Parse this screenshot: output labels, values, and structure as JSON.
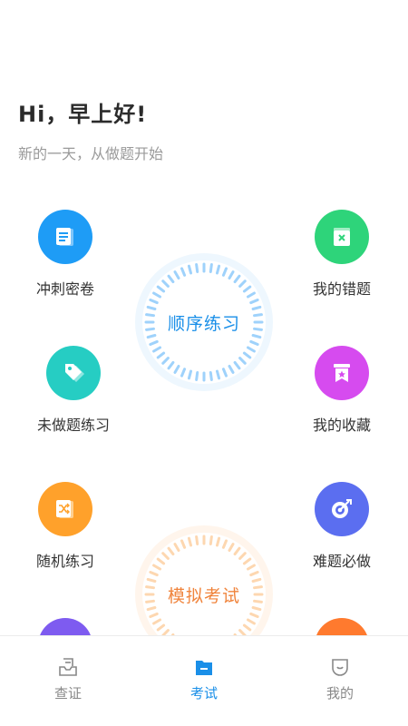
{
  "header": {
    "greeting": "Hi，早上好!",
    "subtitle": "新的一天，从做题开始"
  },
  "features": {
    "left": [
      {
        "label": "冲刺密卷",
        "color": "#1e9cf6",
        "icon": "document-icon"
      },
      {
        "label": "未做题练习",
        "color": "#26cdc3",
        "icon": "tag-icon"
      },
      {
        "label": "随机练习",
        "color": "#ffa12b",
        "icon": "shuffle-icon"
      },
      {
        "label": "",
        "color": "#7e5bf0",
        "icon": "unknown-icon"
      }
    ],
    "right": [
      {
        "label": "我的错题",
        "color": "#2ed47a",
        "icon": "wrong-answers-icon"
      },
      {
        "label": "我的收藏",
        "color": "#d64bef",
        "icon": "bookmark-star-icon"
      },
      {
        "label": "难题必做",
        "color": "#5b6ef0",
        "icon": "target-icon"
      },
      {
        "label": "",
        "color": "#ff7a2e",
        "icon": "unknown-icon"
      }
    ]
  },
  "rings": {
    "sequential": {
      "label": "顺序练习",
      "color": "#1a8fe8",
      "tick_color": "#9fd2fb",
      "halo_color": "#eef7fe"
    },
    "mock_exam": {
      "label": "模拟考试",
      "color": "#f0843c",
      "tick_color": "#fdd7b0",
      "halo_color": "#fff5ec"
    }
  },
  "tabbar": {
    "tabs": [
      {
        "label": "查证",
        "icon": "inbox-icon",
        "active": false
      },
      {
        "label": "考试",
        "icon": "folder-icon",
        "active": true
      },
      {
        "label": "我的",
        "icon": "profile-icon",
        "active": false
      }
    ],
    "active_color": "#1a8fe8",
    "inactive_color": "#888888"
  }
}
